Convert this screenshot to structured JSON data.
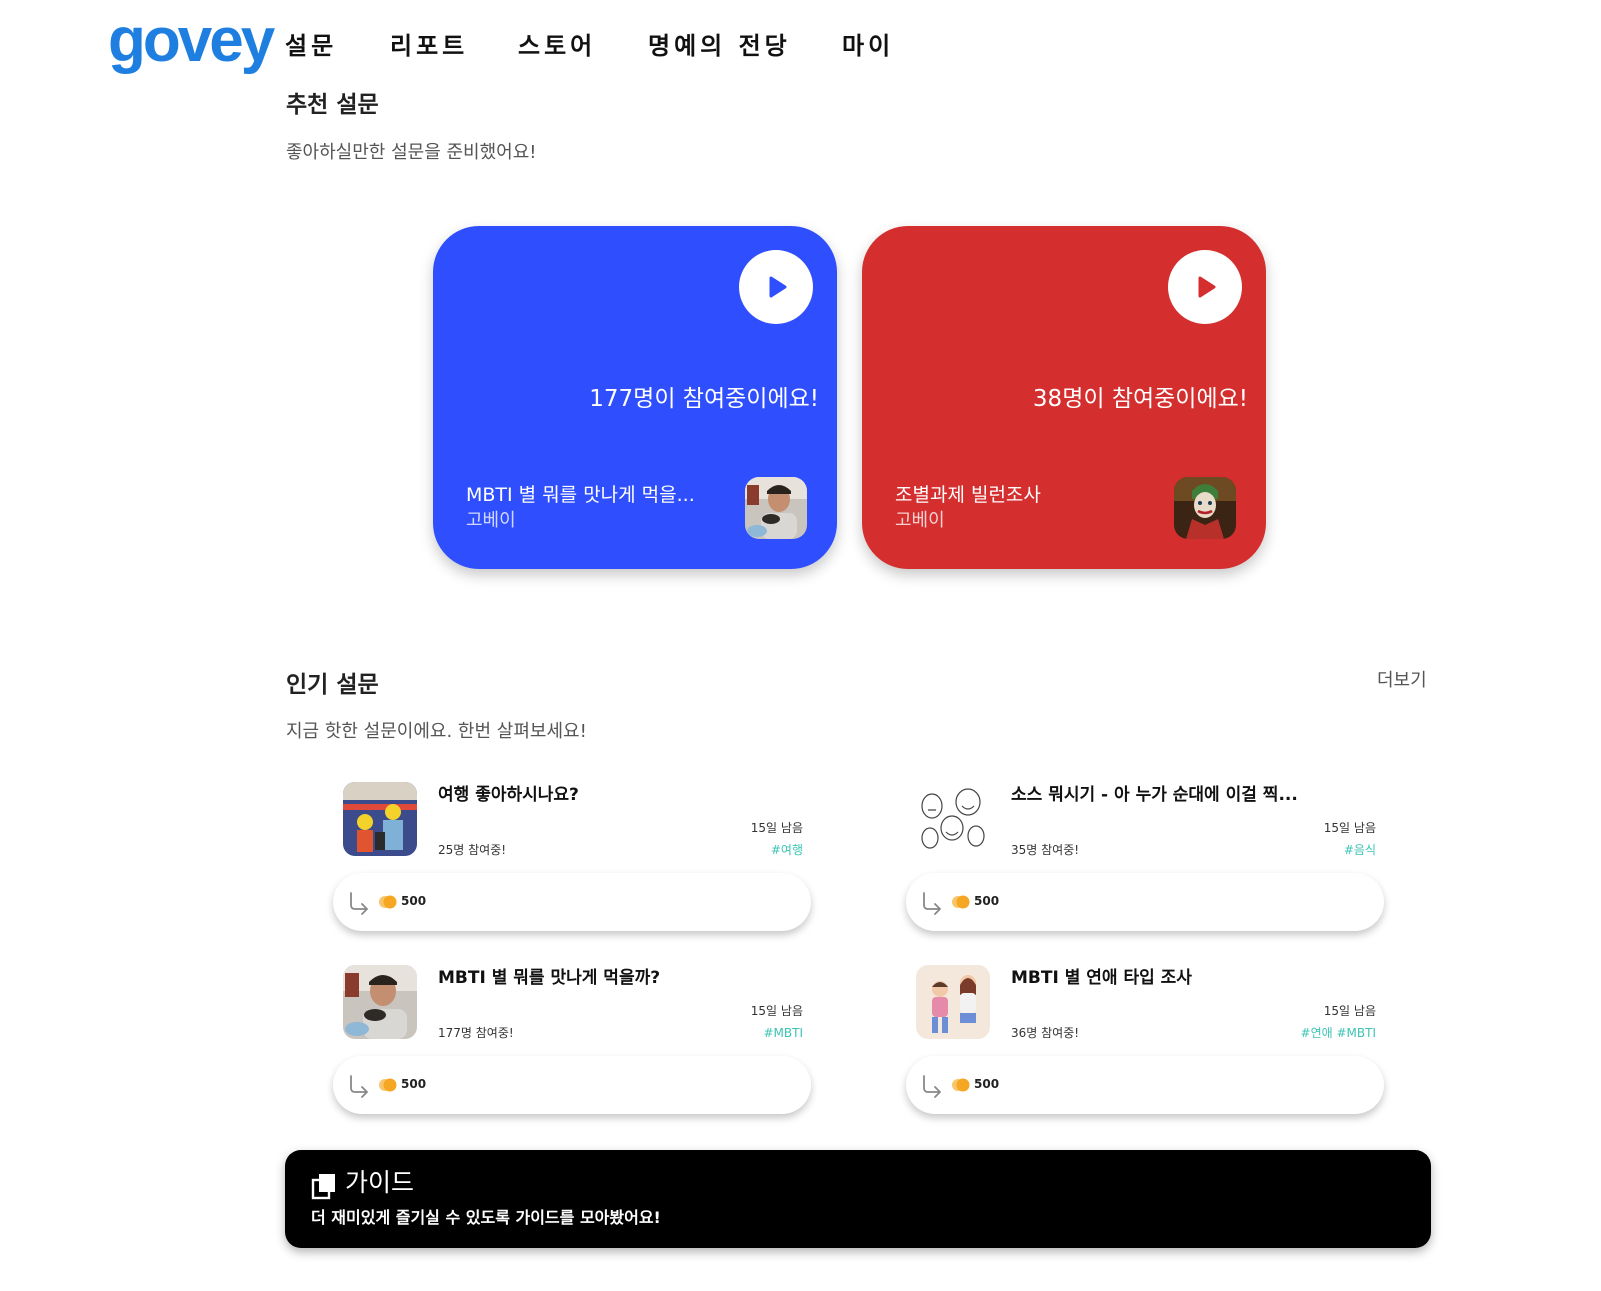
{
  "logo": "govey",
  "nav": [
    "설문",
    "리포트",
    "스토어",
    "명예의 전당",
    "마이"
  ],
  "recommended": {
    "title": "추천 설문",
    "subtitle": "좋아하실만한 설문을 준비했어요!",
    "cards": [
      {
        "participants": "177명이 참여중이에요!",
        "title": "MBTI 별 뭐를 맛나게 먹을...",
        "author": "고베이",
        "color": "#2f4ffe",
        "thumb": "man-eating-thumbnail"
      },
      {
        "participants": "38명이 참여중이에요!",
        "title": "조별과제 빌런조사",
        "author": "고베이",
        "color": "#d42e2e",
        "thumb": "joker-thumbnail"
      }
    ]
  },
  "popular": {
    "title": "인기 설문",
    "subtitle": "지금 핫한 설문이에요. 한번 살펴보세요!",
    "more": "더보기",
    "items": [
      {
        "title": "여행 좋아하시나요?",
        "days": "15일 남음",
        "count": "25명 참여중!",
        "tags": "#여행",
        "reward": "500",
        "thumb": "cartoon-family-thumbnail"
      },
      {
        "title": "소스 뭐시기 - 아 누가 순대에 이걸 찍...",
        "days": "15일 남음",
        "count": "35명 참여중!",
        "tags": "#음식",
        "reward": "500",
        "thumb": "meme-faces-thumbnail"
      },
      {
        "title": "MBTI 별 뭐를 맛나게 먹을까?",
        "days": "15일 남음",
        "count": "177명 참여중!",
        "tags": "#MBTI",
        "reward": "500",
        "thumb": "man-eating-thumbnail"
      },
      {
        "title": "MBTI 별 연애 타입 조사",
        "days": "15일 남음",
        "count": "36명 참여중!",
        "tags": "#연애 #MBTI",
        "reward": "500",
        "thumb": "couple-illustration-thumbnail"
      }
    ]
  },
  "guide": {
    "title": "가이드",
    "subtitle": "더 재미있게 즐기실 수 있도록 가이드를 모아봤어요!"
  },
  "colors": {
    "brand": "#1f7fe0",
    "tag": "#3cc4b4",
    "coin": "#f5a623"
  }
}
